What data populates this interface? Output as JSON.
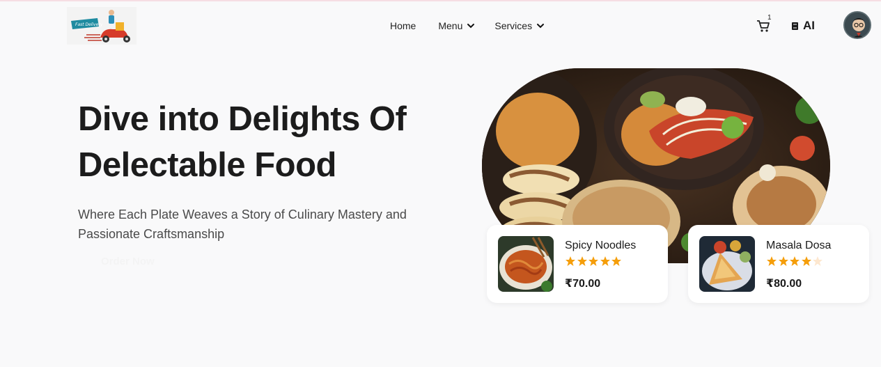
{
  "nav": {
    "logo_text": "Fast Delivery",
    "links": [
      {
        "label": "Home",
        "has_dropdown": false
      },
      {
        "label": "Menu",
        "has_dropdown": true
      },
      {
        "label": "Services",
        "has_dropdown": true
      }
    ],
    "cart_count": "1",
    "ai_label": "AI"
  },
  "hero": {
    "title_line1": "Dive into Delights Of",
    "title_line2": "Delectable Food",
    "subtitle": "Where Each Plate Weaves a Story of Culinary Mastery and Passionate Craftsmanship",
    "cta_label": "Order Now"
  },
  "cards": [
    {
      "name": "Spicy Noodles",
      "rating": 5,
      "max_rating": 5,
      "price": "₹70.00"
    },
    {
      "name": "Masala Dosa",
      "rating": 4,
      "max_rating": 5,
      "price": "₹80.00"
    }
  ],
  "colors": {
    "star": "#f59e0b",
    "star_empty": "#fde7cf",
    "text_dark": "#1c1c1c",
    "background": "#f9f9fa"
  }
}
